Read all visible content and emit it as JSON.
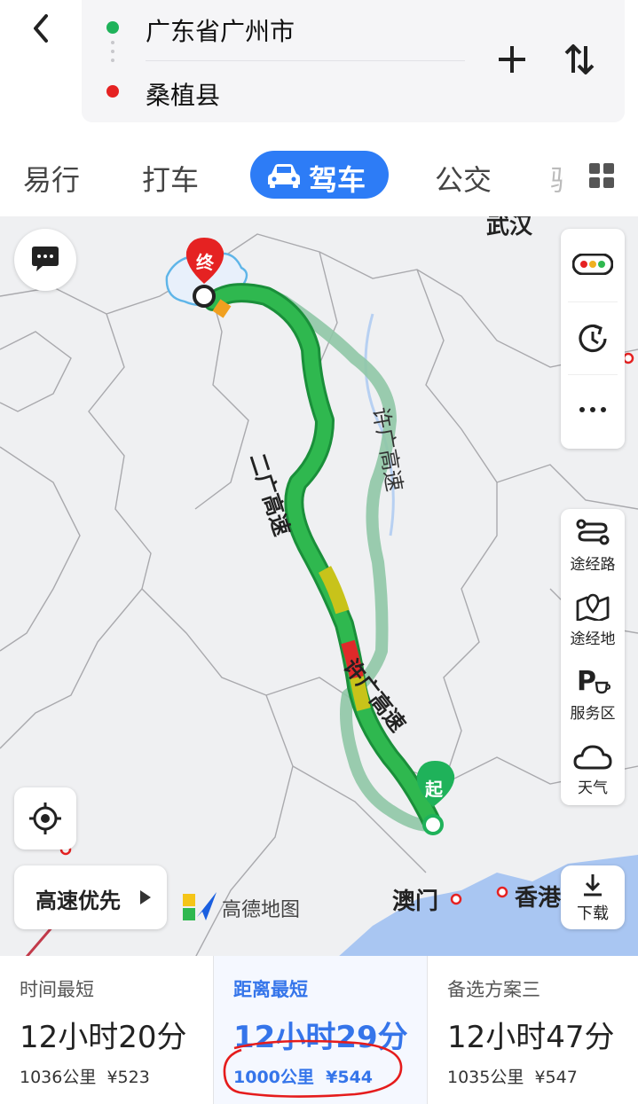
{
  "route": {
    "from": "广东省广州市",
    "to": "桑植县"
  },
  "tabs": [
    "易行",
    "打车",
    "驾车",
    "公交"
  ],
  "active_tab": "驾车",
  "map": {
    "cities": {
      "wuhan": "武汉",
      "macau": "澳门",
      "hongkong": "香港"
    },
    "highways": {
      "a": "二广高速",
      "b": "许广高速",
      "c": "许广高速"
    },
    "start_marker": "起",
    "end_marker": "终",
    "priority_label": "高速优先",
    "brand": "高德地图",
    "side_buttons": [
      "途经路",
      "途经地",
      "服务区",
      "天气"
    ],
    "download_label": "下载"
  },
  "options": [
    {
      "name": "时间最短",
      "time": "12小时20分",
      "distance": "1036公里",
      "toll": "¥523",
      "selected": false
    },
    {
      "name": "距离最短",
      "time": "12小时29分",
      "distance": "1000公里",
      "toll": "¥544",
      "selected": true
    },
    {
      "name": "备选方案三",
      "time": "12小时47分",
      "distance": "1035公里",
      "toll": "¥547",
      "selected": false
    }
  ],
  "colors": {
    "accent": "#2d7cf6",
    "route_green": "#2aa84a",
    "start_green": "#1fb25a",
    "end_red": "#e52222",
    "circle_red": "#e51c1c"
  }
}
